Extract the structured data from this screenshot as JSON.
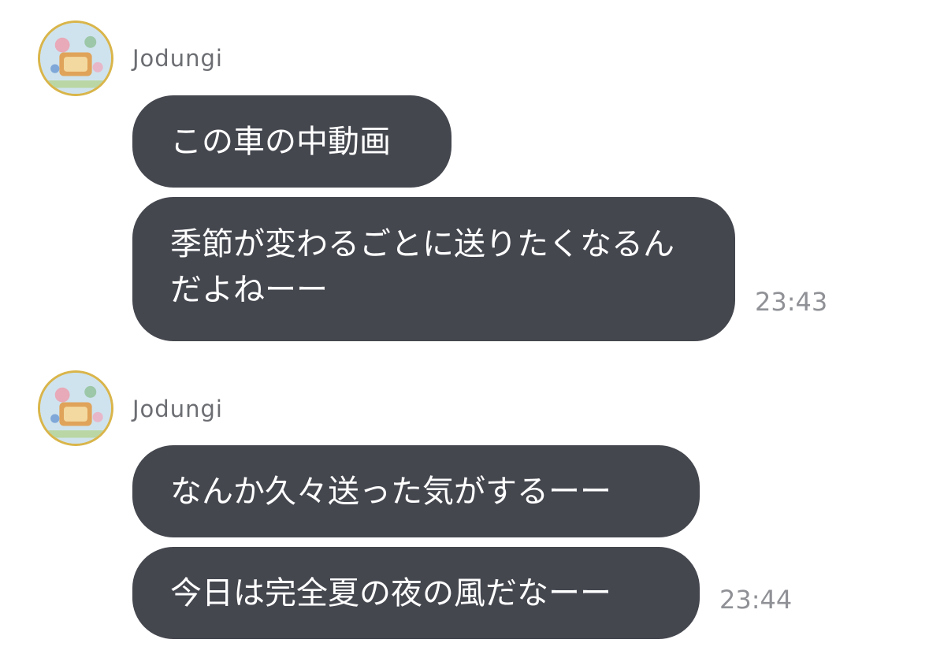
{
  "groups": [
    {
      "sender": "Jodungi",
      "messages": [
        "この車の中動画",
        "季節が変わるごとに送りたくなるんだよねーー"
      ],
      "time": "23:43"
    },
    {
      "sender": "Jodungi",
      "messages": [
        "なんか久々送った気がするーー",
        "今日は完全夏の夜の風だなーー"
      ],
      "time": "23:44"
    }
  ],
  "colors": {
    "bubble": "#45474f",
    "bubble_text": "#ffffff",
    "sender_text": "#6b6d72",
    "time_text": "#8f9196",
    "avatar_ring": "#d9b54a"
  }
}
